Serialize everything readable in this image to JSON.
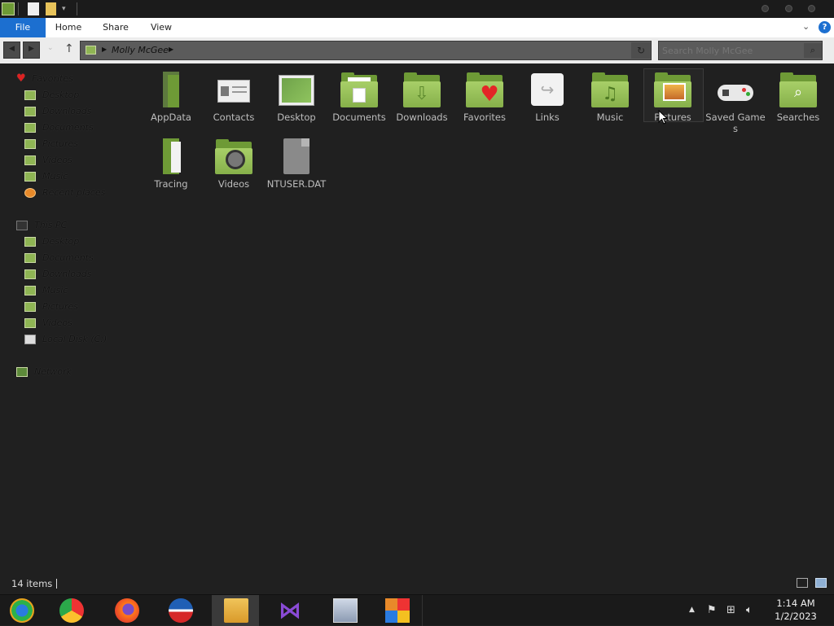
{
  "ribbon": {
    "tabs": [
      "File",
      "Home",
      "Share",
      "View"
    ]
  },
  "address": {
    "path": "Molly McGee"
  },
  "search": {
    "placeholder": "Search Molly McGee"
  },
  "navpane": {
    "favorites_label": "Favorites",
    "favorites": [
      "Desktop",
      "Downloads",
      "Documents",
      "Pictures",
      "Videos",
      "Music",
      "Recent places"
    ],
    "thispc_label": "This PC",
    "thispc": [
      "Desktop",
      "Documents",
      "Downloads",
      "Music",
      "Pictures",
      "Videos",
      "Local Disk (C:)"
    ],
    "network_label": "Network"
  },
  "items": [
    {
      "name": "AppData",
      "icon": "appdata-folder-icon"
    },
    {
      "name": "Contacts",
      "icon": "contacts-icon"
    },
    {
      "name": "Desktop",
      "icon": "desktop-icon"
    },
    {
      "name": "Documents",
      "icon": "documents-folder-icon"
    },
    {
      "name": "Downloads",
      "icon": "downloads-folder-icon"
    },
    {
      "name": "Favorites",
      "icon": "favorites-folder-icon"
    },
    {
      "name": "Links",
      "icon": "links-icon"
    },
    {
      "name": "Music",
      "icon": "music-folder-icon"
    },
    {
      "name": "Pictures",
      "icon": "pictures-folder-icon"
    },
    {
      "name": "Saved Games",
      "icon": "gamepad-icon"
    },
    {
      "name": "Searches",
      "icon": "searches-folder-icon"
    },
    {
      "name": "Tracing",
      "icon": "tracing-folder-icon"
    },
    {
      "name": "Videos",
      "icon": "videos-folder-icon"
    },
    {
      "name": "NTUSER.DAT",
      "icon": "file-icon"
    }
  ],
  "status": {
    "item_count": "14 items"
  },
  "taskbar": {
    "apps": [
      "start-icon",
      "chrome-icon",
      "firefox-icon",
      "obama-logo-icon",
      "file-explorer-icon",
      "visual-studio-icon",
      "image-viewer-icon",
      "app-icon"
    ],
    "time": "1:14 AM",
    "date": "1/2/2023"
  },
  "colors": {
    "accent": "#1c6fd0",
    "folder": "#8fb554",
    "background": "#202020"
  }
}
